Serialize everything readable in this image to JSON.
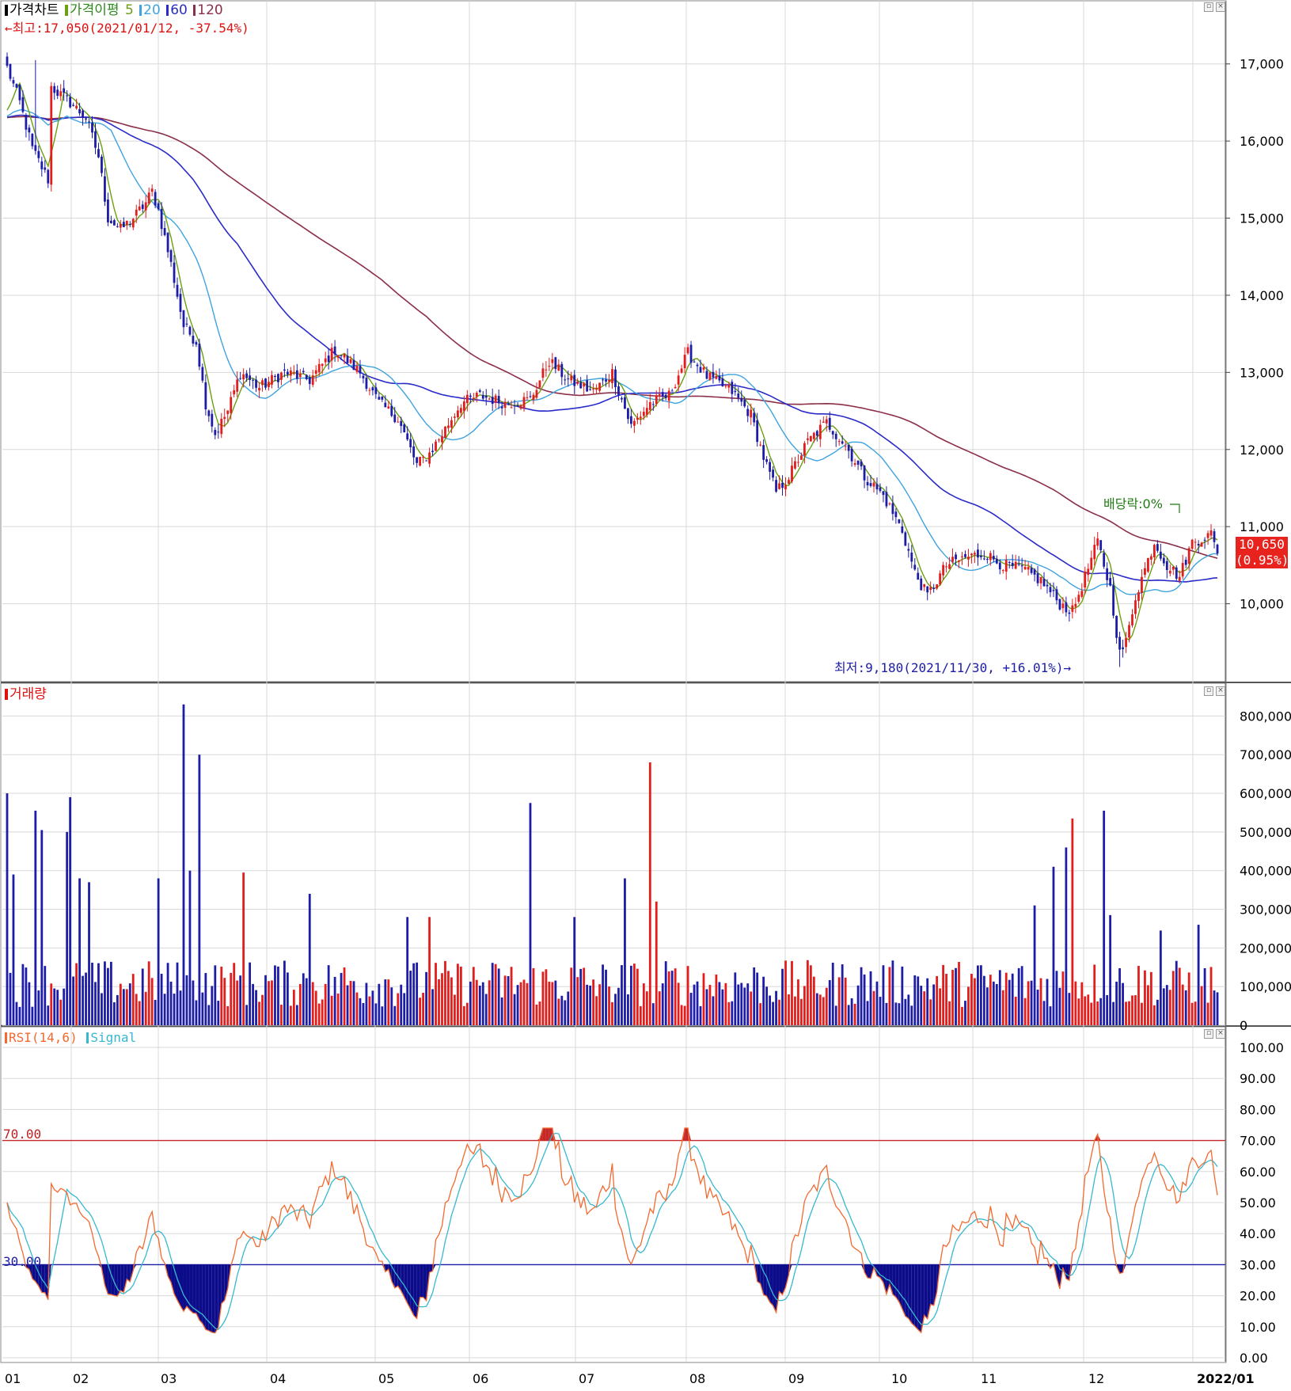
{
  "panels": {
    "price": {
      "legend": {
        "chart_label": "가격차트",
        "ma_label": "가격이평",
        "ma5": "5",
        "ma20": "20",
        "ma60": "60",
        "ma120": "120"
      },
      "high_note": "←최고:17,050(2021/01/12, -37.54%)",
      "low_note": "최저:9,180(2021/11/30, +16.01%)→",
      "dividend_note": "배당락:0%",
      "last_price": "10,650",
      "last_change": "(0.95%)",
      "axis_ticks": [
        "17,000",
        "16,000",
        "15,000",
        "14,000",
        "13,000",
        "12,000",
        "11,000",
        "10,000"
      ]
    },
    "volume": {
      "legend": "거래량",
      "axis_ticks": [
        "800,000",
        "700,000",
        "600,000",
        "500,000",
        "400,000",
        "300,000",
        "200,000",
        "100,000",
        "0"
      ]
    },
    "rsi": {
      "legend_rsi": "RSI(14,6)",
      "legend_signal": "Signal",
      "upper_label": "70.00",
      "lower_label": "30.00",
      "axis_ticks": [
        "100.00",
        "90.00",
        "80.00",
        "70.00",
        "60.00",
        "50.00",
        "40.00",
        "30.00",
        "20.00",
        "10.00",
        "0.00"
      ]
    }
  },
  "x_axis": {
    "labels": [
      "01",
      "02",
      "03",
      "04",
      "05",
      "06",
      "07",
      "08",
      "09",
      "10",
      "11",
      "12",
      "2022/01"
    ]
  },
  "colors": {
    "up": "#e31c1c",
    "down": "#1c1ca6",
    "ma5": "#6aa012",
    "ma20": "#3ea3e0",
    "ma60": "#2b2bc9",
    "ma120": "#8b2f48",
    "rsi": "#f26a30",
    "signal": "#38b8cf",
    "grid": "#d8d8d8"
  },
  "chart_data": [
    {
      "type": "candlestick",
      "title": "가격차트",
      "x_labels": [
        "01",
        "02",
        "03",
        "04",
        "05",
        "06",
        "07",
        "08",
        "09",
        "10",
        "11",
        "12",
        "2022/01"
      ],
      "ylim": [
        9000,
        17500
      ],
      "y_ticks": [
        10000,
        11000,
        12000,
        13000,
        14000,
        15000,
        16000,
        17000
      ],
      "anchors": [
        [
          0,
          16950
        ],
        [
          4,
          16500
        ],
        [
          8,
          15900
        ],
        [
          13,
          15500
        ],
        [
          14,
          16700
        ],
        [
          20,
          16500
        ],
        [
          25,
          16300
        ],
        [
          29,
          15800
        ],
        [
          32,
          15000
        ],
        [
          36,
          14850
        ],
        [
          40,
          15000
        ],
        [
          44,
          15200
        ],
        [
          46,
          15350
        ],
        [
          48,
          15100
        ],
        [
          52,
          14400
        ],
        [
          56,
          13600
        ],
        [
          60,
          13400
        ],
        [
          63,
          12600
        ],
        [
          66,
          12200
        ],
        [
          70,
          12500
        ],
        [
          74,
          13000
        ],
        [
          80,
          12800
        ],
        [
          88,
          13000
        ],
        [
          96,
          12900
        ],
        [
          104,
          13300
        ],
        [
          112,
          13000
        ],
        [
          118,
          12600
        ],
        [
          124,
          12400
        ],
        [
          130,
          11800
        ],
        [
          134,
          11950
        ],
        [
          138,
          12200
        ],
        [
          144,
          12600
        ],
        [
          150,
          12700
        ],
        [
          158,
          12600
        ],
        [
          166,
          12650
        ],
        [
          172,
          13150
        ],
        [
          178,
          12900
        ],
        [
          186,
          12750
        ],
        [
          192,
          13000
        ],
        [
          198,
          12300
        ],
        [
          204,
          12600
        ],
        [
          210,
          12700
        ],
        [
          216,
          13250
        ],
        [
          222,
          12950
        ],
        [
          230,
          12750
        ],
        [
          236,
          12450
        ],
        [
          240,
          11900
        ],
        [
          244,
          11450
        ],
        [
          248,
          11650
        ],
        [
          254,
          12100
        ],
        [
          260,
          12350
        ],
        [
          266,
          12050
        ],
        [
          272,
          11650
        ],
        [
          278,
          11400
        ],
        [
          284,
          10950
        ],
        [
          288,
          10400
        ],
        [
          292,
          10100
        ],
        [
          298,
          10500
        ],
        [
          304,
          10600
        ],
        [
          310,
          10650
        ],
        [
          316,
          10500
        ],
        [
          322,
          10450
        ],
        [
          328,
          10300
        ],
        [
          334,
          10000
        ],
        [
          338,
          9900
        ],
        [
          342,
          10350
        ],
        [
          346,
          10800
        ],
        [
          350,
          10200
        ],
        [
          353,
          9350
        ],
        [
          355,
          9500
        ],
        [
          358,
          10100
        ],
        [
          364,
          10800
        ],
        [
          368,
          10500
        ],
        [
          372,
          10350
        ],
        [
          376,
          10800
        ],
        [
          382,
          10900
        ],
        [
          384,
          10650
        ]
      ],
      "series": [
        {
          "name": "5",
          "type": "ma",
          "period": 5
        },
        {
          "name": "20",
          "type": "ma",
          "period": 20
        },
        {
          "name": "60",
          "type": "ma",
          "period": 60
        },
        {
          "name": "120",
          "type": "ma",
          "period": 120
        }
      ],
      "high": {
        "value": 17050,
        "date": "2021/01/12",
        "pct": "-37.54%"
      },
      "low": {
        "value": 9180,
        "date": "2021/11/30",
        "pct": "+16.01%"
      },
      "last": 10650
    },
    {
      "type": "bar",
      "title": "거래량",
      "ylim": [
        0,
        850000
      ],
      "y_ticks": [
        0,
        100000,
        200000,
        300000,
        400000,
        500000,
        600000,
        700000,
        800000
      ],
      "spikes": [
        [
          0,
          600000
        ],
        [
          2,
          390000
        ],
        [
          9,
          555000
        ],
        [
          11,
          505000
        ],
        [
          19,
          500000
        ],
        [
          20,
          590000
        ],
        [
          23,
          380000
        ],
        [
          26,
          370000
        ],
        [
          48,
          380000
        ],
        [
          56,
          830000
        ],
        [
          58,
          400000
        ],
        [
          61,
          700000
        ],
        [
          75,
          395000
        ],
        [
          96,
          340000
        ],
        [
          127,
          280000
        ],
        [
          134,
          280000
        ],
        [
          166,
          575000
        ],
        [
          180,
          280000
        ],
        [
          196,
          380000
        ],
        [
          204,
          680000
        ],
        [
          206,
          320000
        ],
        [
          326,
          310000
        ],
        [
          332,
          410000
        ],
        [
          336,
          460000
        ],
        [
          338,
          535000
        ],
        [
          348,
          555000
        ],
        [
          350,
          285000
        ],
        [
          366,
          245000
        ],
        [
          378,
          260000
        ]
      ],
      "base_mean": 135000
    },
    {
      "type": "line",
      "title": "RSI(14,6)",
      "ylim": [
        0,
        100
      ],
      "y_ticks": [
        0,
        10,
        20,
        30,
        40,
        50,
        60,
        70,
        80,
        90,
        100
      ],
      "thresholds": [
        70,
        30
      ],
      "series": [
        {
          "name": "RSI(14,6)"
        },
        {
          "name": "Signal"
        }
      ]
    }
  ]
}
